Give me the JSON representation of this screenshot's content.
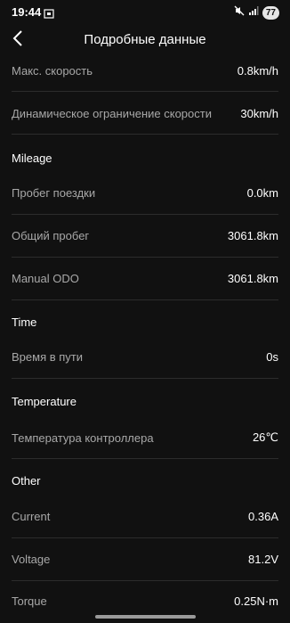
{
  "status_bar": {
    "time": "19:44",
    "battery": "77",
    "icons": [
      "screenshot-icon",
      "mute-icon",
      "signal-icon"
    ]
  },
  "header": {
    "title": "Подробные данные",
    "back_icon": "chevron-left-icon"
  },
  "speed": {
    "max_speed_label": "Макс. скорость",
    "max_speed_value": "0.8km/h",
    "dynamic_limit_label": "Динамическое ограничение скорости",
    "dynamic_limit_value": "30km/h"
  },
  "mileage": {
    "title": "Mileage",
    "trip_label": "Пробег поездки",
    "trip_value": "0.0km",
    "total_label": "Общий пробег",
    "total_value": "3061.8km",
    "manual_odo_label": "Manual ODO",
    "manual_odo_value": "3061.8km"
  },
  "time": {
    "title": "Time",
    "travel_time_label": "Время в пути",
    "travel_time_value": "0s"
  },
  "temperature": {
    "title": "Temperature",
    "controller_label": "Температура контроллера",
    "controller_value": "26℃"
  },
  "other": {
    "title": "Other",
    "current_label": "Current",
    "current_value": "0.36A",
    "voltage_label": "Voltage",
    "voltage_value": "81.2V",
    "torque_label": "Torque",
    "torque_value": "0.25N·m"
  }
}
